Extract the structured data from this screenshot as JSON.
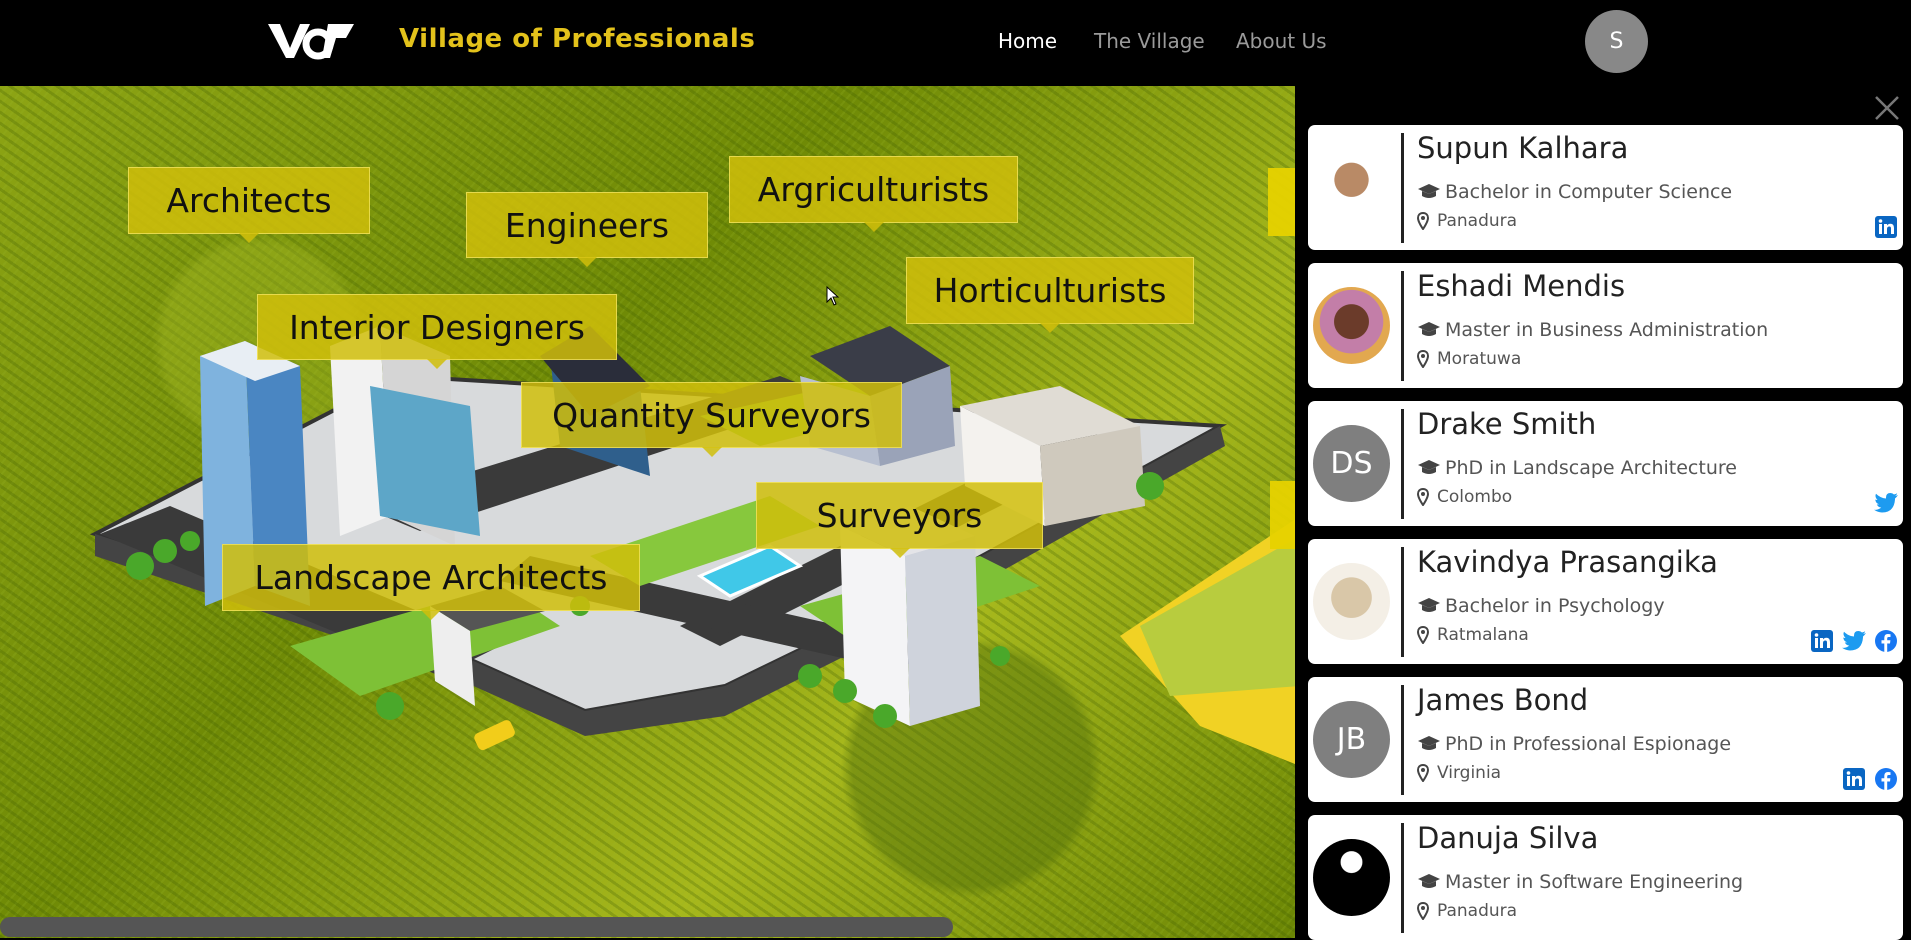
{
  "header": {
    "logo_text": "VoP",
    "brand": "Village of Professionals",
    "nav": [
      {
        "label": "Home",
        "active": true
      },
      {
        "label": "The Village",
        "active": false
      },
      {
        "label": "About Us",
        "active": false
      }
    ],
    "user_initial": "S"
  },
  "map": {
    "categories": [
      "Architects",
      "Engineers",
      "Argriculturists",
      "Horticulturists",
      "Interior Designers",
      "Quantity Surveyors",
      "Surveyors",
      "Landscape Architects"
    ]
  },
  "panel": {
    "close_icon": "close-icon",
    "profiles": [
      {
        "name": "Supun Kalhara",
        "degree": "Bachelor in Computer Science",
        "location": "Panadura",
        "initials": "",
        "socials": [
          "linkedin"
        ]
      },
      {
        "name": "Eshadi Mendis",
        "degree": "Master in Business Administration",
        "location": "Moratuwa",
        "initials": "",
        "socials": []
      },
      {
        "name": "Drake Smith",
        "degree": "PhD in Landscape Architecture",
        "location": "Colombo",
        "initials": "DS",
        "socials": [
          "twitter"
        ]
      },
      {
        "name": "Kavindya Prasangika",
        "degree": "Bachelor in Psychology",
        "location": "Ratmalana",
        "initials": "",
        "socials": [
          "linkedin",
          "twitter",
          "facebook"
        ]
      },
      {
        "name": "James Bond",
        "degree": "PhD in Professional Espionage",
        "location": "Virginia",
        "initials": "JB",
        "socials": [
          "linkedin",
          "facebook"
        ]
      },
      {
        "name": "Danuja Silva",
        "degree": "Master in Software Engineering",
        "location": "Panadura",
        "initials": "",
        "socials": []
      }
    ]
  },
  "colors": {
    "brand_yellow": "#e3c21b",
    "linkedin": "#0a66c2",
    "twitter": "#1d9bf0",
    "facebook": "#1877f2"
  }
}
